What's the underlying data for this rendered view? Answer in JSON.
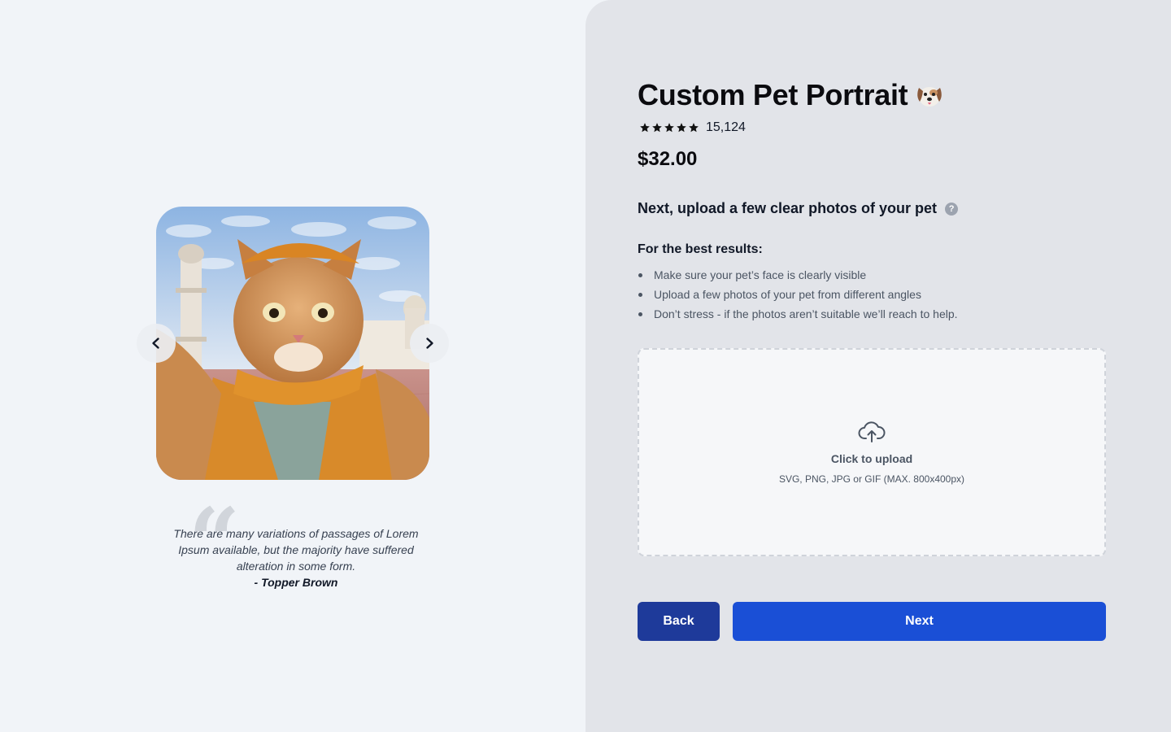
{
  "carousel": {
    "prev_icon": "chevron-left-icon",
    "next_icon": "chevron-right-icon",
    "image_icon": "cat-selfie-photo"
  },
  "testimonial": {
    "text": "There are many variations of passages of Lorem Ipsum available, but the majority have suffered alteration in some form.",
    "author": "- Topper Brown"
  },
  "product": {
    "title": "Custom Pet Portrait",
    "title_icon": "dog-face-icon",
    "rating": 5,
    "rating_max": 5,
    "rating_count": "15,124",
    "price": "$32.00"
  },
  "step": {
    "heading": "Next, upload a few clear photos of your pet",
    "help_icon": "question-icon",
    "help_glyph": "?",
    "tips_heading": "For the best results:",
    "tips": [
      "Make sure your pet’s face is clearly visible",
      "Upload a few photos of your pet from different angles",
      "Don’t stress - if the photos aren’t suitable we’ll reach to help."
    ]
  },
  "upload": {
    "title": "Click to upload",
    "subtitle": "SVG, PNG, JPG or GIF (MAX. 800x400px)",
    "icon": "cloud-upload-icon"
  },
  "actions": {
    "back_label": "Back",
    "next_label": "Next"
  },
  "colors": {
    "back_button": "#1e3a9a",
    "next_button": "#1a4fd6",
    "right_panel": "#e2e4e9",
    "left_panel": "#f1f4f8"
  }
}
